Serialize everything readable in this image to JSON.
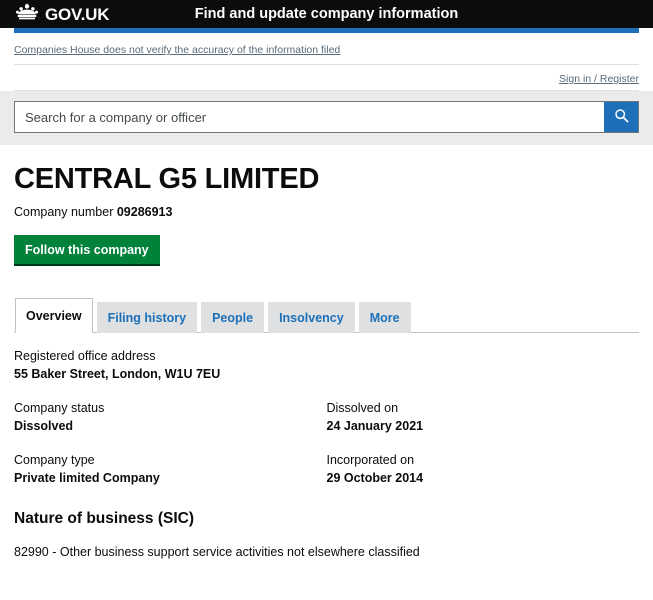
{
  "header": {
    "brand": "GOV.UK",
    "crown_icon": "crown-icon",
    "service_name": "Find and update company information"
  },
  "notice": {
    "text": "Companies House does not verify the accuracy of the information filed"
  },
  "account": {
    "signin_label": "Sign in / Register"
  },
  "search": {
    "placeholder": "Search for a company or officer",
    "value": "",
    "submit_icon": "search-icon",
    "submit_label": "Search"
  },
  "company": {
    "name": "CENTRAL G5 LIMITED",
    "number_label": "Company number",
    "number": "09286913",
    "follow_label": "Follow this company"
  },
  "tabs": [
    {
      "label": "Overview",
      "active": true
    },
    {
      "label": "Filing history",
      "active": false
    },
    {
      "label": "People",
      "active": false
    },
    {
      "label": "Insolvency",
      "active": false
    },
    {
      "label": "More",
      "active": false
    }
  ],
  "details": {
    "address_label": "Registered office address",
    "address_value": "55 Baker Street, London, W1U 7EU",
    "status_label": "Company status",
    "status_value": "Dissolved",
    "dissolved_label": "Dissolved on",
    "dissolved_value": "24 January 2021",
    "type_label": "Company type",
    "type_value": "Private limited Company",
    "incorporated_label": "Incorporated on",
    "incorporated_value": "29 October 2014"
  },
  "sic": {
    "heading": "Nature of business (SIC)",
    "items": [
      "82990 - Other business support service activities not elsewhere classified"
    ]
  },
  "colors": {
    "header_black": "#0b0c0c",
    "accent_blue": "#1d70b8",
    "link_grey": "#5a6b7a",
    "green_button": "#00823b",
    "search_band": "#ebebeb",
    "tab_inactive": "#dee0e2"
  }
}
